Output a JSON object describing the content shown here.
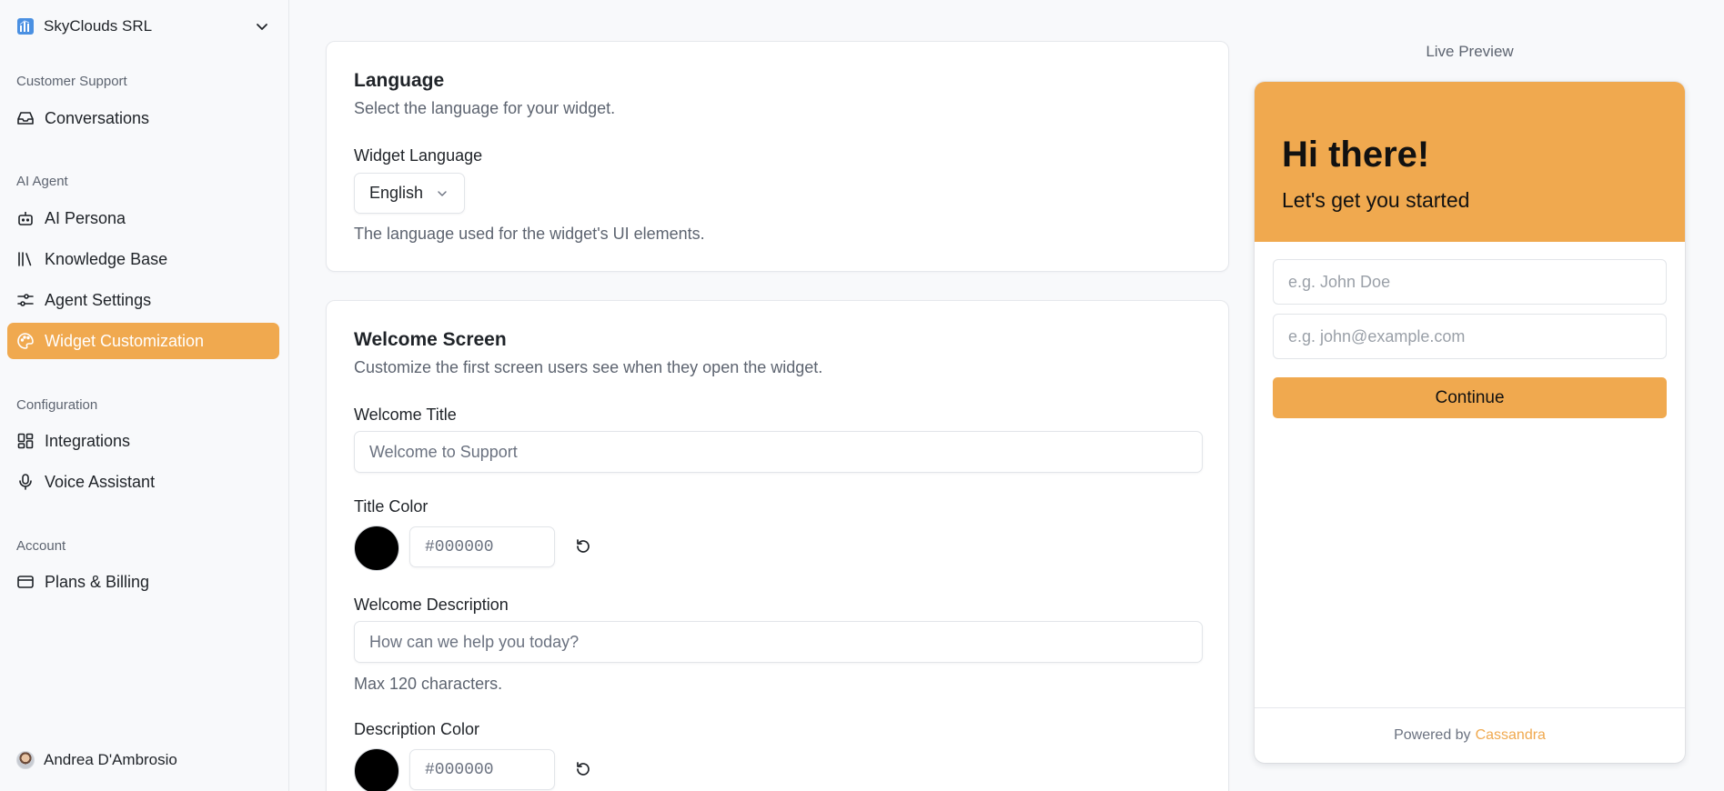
{
  "sidebar": {
    "org_name": "SkyClouds SRL",
    "sections": {
      "customer_support": "Customer Support",
      "ai_agent": "AI Agent",
      "configuration": "Configuration",
      "account": "Account"
    },
    "items": {
      "conversations": "Conversations",
      "ai_persona": "AI Persona",
      "knowledge_base": "Knowledge Base",
      "agent_settings": "Agent Settings",
      "widget_customization": "Widget Customization",
      "integrations": "Integrations",
      "voice_assistant": "Voice Assistant",
      "plans_billing": "Plans & Billing"
    },
    "active_item": "widget_customization",
    "user_name": "Andrea D'Ambrosio"
  },
  "language_card": {
    "title": "Language",
    "subtitle": "Select the language for your widget.",
    "field_label": "Widget Language",
    "selected_language": "English",
    "help": "The language used for the widget's UI elements."
  },
  "welcome_card": {
    "title": "Welcome Screen",
    "subtitle": "Customize the first screen users see when they open the widget.",
    "welcome_title_label": "Welcome Title",
    "welcome_title_placeholder": "Welcome to Support",
    "title_color_label": "Title Color",
    "title_color_placeholder": "#000000",
    "title_color_value": "#000000",
    "welcome_desc_label": "Welcome Description",
    "welcome_desc_placeholder": "How can we help you today?",
    "desc_help": "Max 120 characters.",
    "desc_color_label": "Description Color",
    "desc_color_placeholder": "#000000",
    "desc_color_value": "#000000"
  },
  "preview": {
    "label": "Live Preview",
    "title": "Hi there!",
    "description": "Let's get you started",
    "name_placeholder": "e.g. John Doe",
    "email_placeholder": "e.g. john@example.com",
    "button": "Continue",
    "powered_by": "Powered by",
    "brand": "Cassandra"
  },
  "colors": {
    "accent": "#f0a94f",
    "background": "#f8f9fb",
    "card": "#ffffff",
    "text": "#1f2328",
    "muted": "#5d6470"
  }
}
